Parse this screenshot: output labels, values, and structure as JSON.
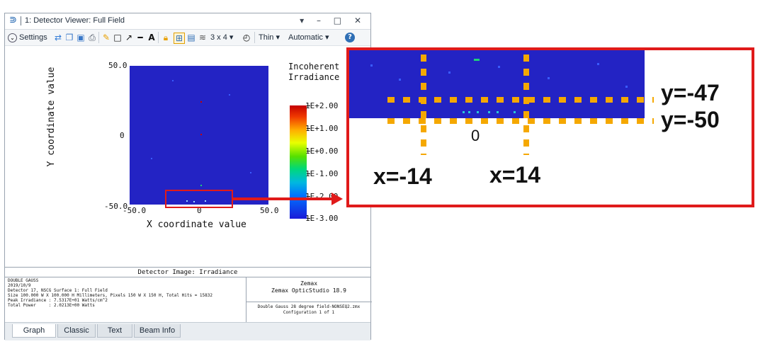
{
  "window": {
    "title": "1: Detector Viewer: Full Field",
    "title_controls": "▾ – □ ✕"
  },
  "toolbar": {
    "settings_label": "Settings",
    "layout_label": "3 x 4 ▾",
    "thin_label": "Thin ▾",
    "automatic_label": "Automatic ▾"
  },
  "plot": {
    "y_axis_label": "Y coordinate value",
    "x_axis_label": "X coordinate value",
    "y_ticks": [
      "50.0",
      "0",
      "-50.0"
    ],
    "x_ticks": [
      "-50.0",
      "0",
      "50.0"
    ],
    "colorbar_title_1": "Incoherent",
    "colorbar_title_2": "Irradiance",
    "colorbar_ticks": [
      "1E+2.00",
      "1E+1.00",
      "1E+0.00",
      "1E-1.00",
      "1E-2.00",
      "1E-3.00"
    ]
  },
  "info": {
    "title": "Detector Image: Irradiance",
    "left_text": "DOUBLE GAUSS\n2019/10/9\nDetector 17, NSCG Surface 1: Full Field\nSize 100.000 W X 100.000 H Millimeters, Pixels 150 W X 150 H, Total Hits = 15832\nPeak Irradiance : 7.5317E+01 Watts/cm^2\nTotal Power     : 2.0213E+00 Watts",
    "right_line1": "Zemax",
    "right_line2": "Zemax OpticStudio 18.9",
    "right_file": "Double Gauss 28 degree field-NONSEQ2.zmx",
    "right_config": "Configuration 1 of 1"
  },
  "tabs": [
    "Graph",
    "Classic",
    "Text",
    "Beam Info"
  ],
  "zoom": {
    "label_y47": "y=-47",
    "label_y50": "y=-50",
    "label_x_neg": "x=-14",
    "label_x_pos": "x=14",
    "label_zero": "0"
  },
  "colors": {
    "highlight_red": "#e01a1a",
    "guide_orange": "#f5a800",
    "detector_blue": "#2323c4"
  }
}
